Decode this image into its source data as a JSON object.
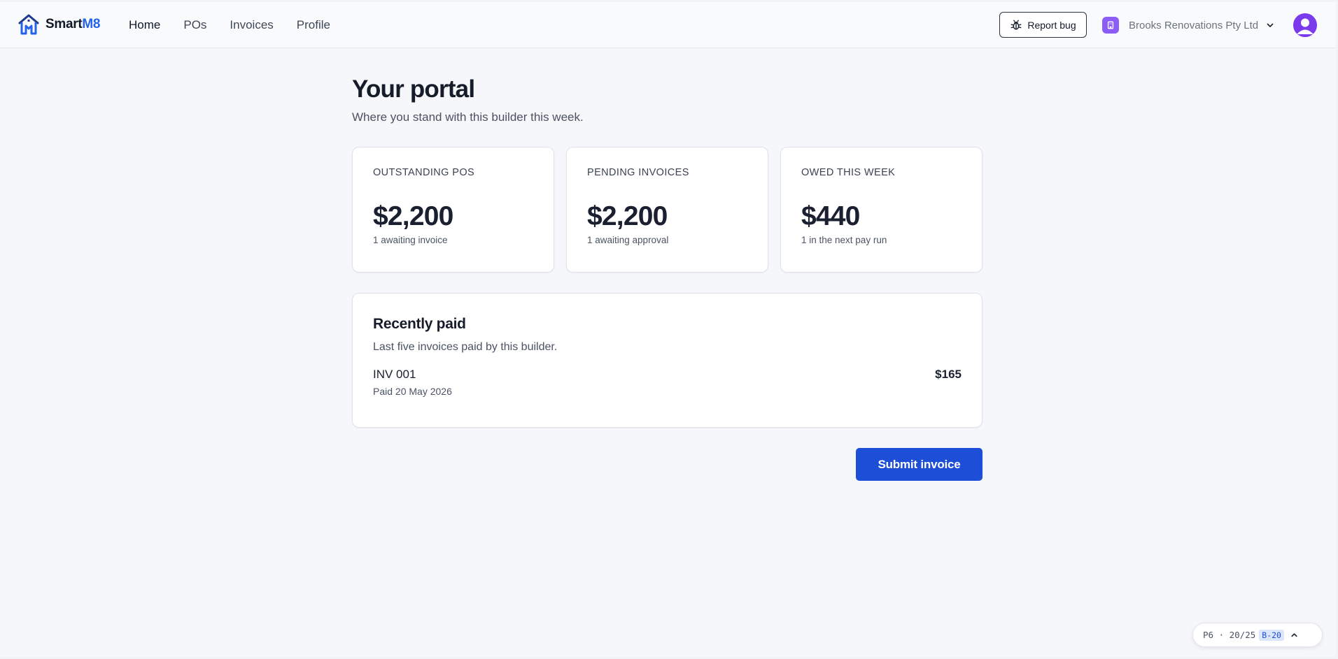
{
  "brand": {
    "name_prefix": "Smart",
    "name_accent": "M8",
    "logo_icon": "house-logo-icon",
    "accent_color": "#2563eb"
  },
  "nav": {
    "items": [
      {
        "label": "Home",
        "active": true
      },
      {
        "label": "POs",
        "active": false
      },
      {
        "label": "Invoices",
        "active": false
      },
      {
        "label": "Profile",
        "active": false
      }
    ]
  },
  "header": {
    "report_bug_label": "Report bug",
    "report_bug_icon": "bug-icon",
    "org_name": "Brooks Renovations Pty Ltd",
    "org_icon": "building-icon",
    "org_color": "#8b5cf6",
    "avatar_icon": "user-avatar-icon"
  },
  "page": {
    "title": "Your portal",
    "subtitle": "Where you stand with this builder this week."
  },
  "stats": [
    {
      "label": "OUTSTANDING POS",
      "value": "$2,200",
      "note": "1 awaiting invoice"
    },
    {
      "label": "PENDING INVOICES",
      "value": "$2,200",
      "note": "1 awaiting approval"
    },
    {
      "label": "OWED THIS WEEK",
      "value": "$440",
      "note": "1 in the next pay run"
    }
  ],
  "recently_paid": {
    "title": "Recently paid",
    "subtitle": "Last five invoices paid by this builder.",
    "items": [
      {
        "invoice": "INV 001",
        "date": "Paid 20 May 2026",
        "amount": "$165"
      }
    ]
  },
  "actions": {
    "submit_label": "Submit invoice",
    "primary_color": "#1d4ed8"
  },
  "dev_panel": {
    "text": "P6 · 20/25",
    "badge": "B-20"
  }
}
